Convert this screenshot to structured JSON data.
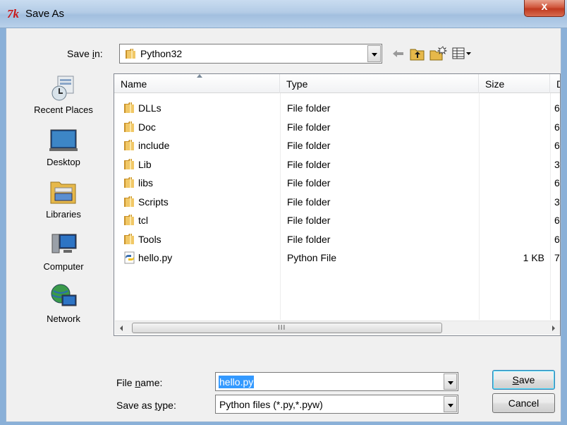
{
  "window": {
    "title": "Save As",
    "close_glyph": "x"
  },
  "save_in": {
    "label_pre": "Save ",
    "label_accel": "i",
    "label_post": "n:",
    "value": "Python32"
  },
  "places": [
    {
      "name": "recent-places",
      "label": "Recent Places",
      "icon": "recent-places-icon"
    },
    {
      "name": "desktop",
      "label": "Desktop",
      "icon": "desktop-icon"
    },
    {
      "name": "libraries",
      "label": "Libraries",
      "icon": "libraries-icon"
    },
    {
      "name": "computer",
      "label": "Computer",
      "icon": "computer-icon"
    },
    {
      "name": "network",
      "label": "Network",
      "icon": "network-icon"
    }
  ],
  "columns": {
    "name": "Name",
    "type": "Type",
    "size": "Size",
    "date": "D"
  },
  "files": [
    {
      "name": "DLLs",
      "type": "File folder",
      "size": "",
      "date": "6",
      "kind": "folder"
    },
    {
      "name": "Doc",
      "type": "File folder",
      "size": "",
      "date": "6",
      "kind": "folder"
    },
    {
      "name": "include",
      "type": "File folder",
      "size": "",
      "date": "6",
      "kind": "folder"
    },
    {
      "name": "Lib",
      "type": "File folder",
      "size": "",
      "date": "3",
      "kind": "folder"
    },
    {
      "name": "libs",
      "type": "File folder",
      "size": "",
      "date": "6",
      "kind": "folder"
    },
    {
      "name": "Scripts",
      "type": "File folder",
      "size": "",
      "date": "3",
      "kind": "folder"
    },
    {
      "name": "tcl",
      "type": "File folder",
      "size": "",
      "date": "6",
      "kind": "folder"
    },
    {
      "name": "Tools",
      "type": "File folder",
      "size": "",
      "date": "6",
      "kind": "folder"
    },
    {
      "name": "hello.py",
      "type": "Python File",
      "size": "1 KB",
      "date": "7",
      "kind": "python"
    }
  ],
  "scrollbar": {
    "grip": "III"
  },
  "file_name": {
    "label_pre": "File ",
    "label_accel": "n",
    "label_post": "ame:",
    "value": "hello.py"
  },
  "save_type": {
    "label_pre": "Save as ",
    "label_accel": "t",
    "label_post": "ype:",
    "value": "Python files (*.py,*.pyw)"
  },
  "buttons": {
    "save_accel": "S",
    "save_rest": "ave",
    "cancel": "Cancel"
  },
  "colors": {
    "selection": "#3399ff",
    "folder": "#e8b84a",
    "title_gradient": "#b3cbe6"
  }
}
